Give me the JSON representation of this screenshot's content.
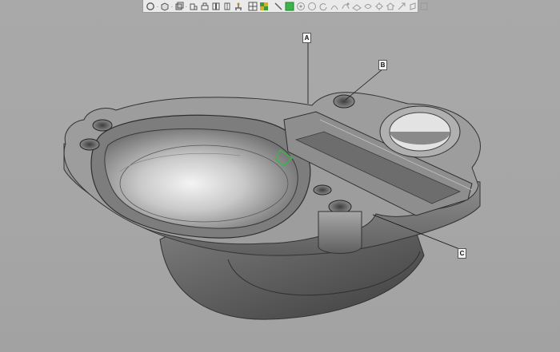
{
  "toolbar": {
    "icons": [
      "rotate-icon",
      "cube-view-icon",
      "view-mode-icon",
      "part-view-icon",
      "front-view-icon",
      "side-view-icon",
      "split-view-icon",
      "fixture-icon",
      "grid-icon",
      "color-grid-icon",
      "line-tool-icon",
      "green-square-icon",
      "target-icon",
      "circle-icon",
      "refresh-icon",
      "sweep-icon",
      "curve-icon",
      "plane-icon",
      "shell-icon",
      "settings-icon",
      "home-icon",
      "expand-icon",
      "shape-icon",
      "box-icon"
    ],
    "accent": "#39b54a"
  },
  "annotations": {
    "a": "A",
    "b": "B",
    "c": "C"
  },
  "model": {
    "body_color": "#8c8c8c",
    "highlight_color": "#e8e8e8"
  }
}
